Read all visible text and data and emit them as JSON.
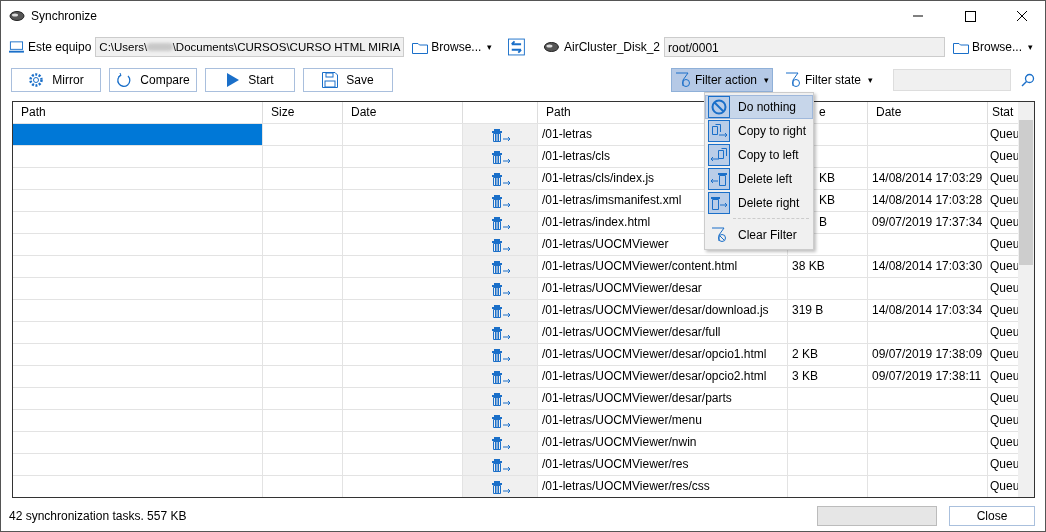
{
  "window": {
    "title": "Synchronize"
  },
  "left_location": {
    "label": "Este equipo",
    "path_before": "C:\\Users\\",
    "path_after": "\\Documents\\CURSOS\\CURSO HTML MIRIA",
    "browse": "Browse...",
    "caret": "▾"
  },
  "right_location": {
    "label": "AirCluster_Disk_2",
    "path": "root/0001",
    "browse": "Browse...",
    "caret": "▾"
  },
  "toolbar": {
    "buttons": [
      {
        "kind": "mirror",
        "label": "Mirror"
      },
      {
        "kind": "compare",
        "label": "Compare"
      },
      {
        "kind": "start",
        "label": "Start"
      },
      {
        "kind": "save",
        "label": "Save"
      }
    ],
    "filter_action": {
      "label": "Filter action",
      "caret": "▾",
      "open": true
    },
    "filter_state": {
      "label": "Filter state",
      "caret": "▾"
    }
  },
  "table": {
    "columns": [
      "Path",
      "Size",
      "Date",
      "",
      "Path",
      "e",
      "Date",
      "Stat"
    ],
    "rows": [
      {
        "right_path": "/01-letras",
        "size": "",
        "date": "",
        "state": "Queu",
        "selected": true
      },
      {
        "right_path": "/01-letras/cls",
        "size": "",
        "date": "",
        "state": "Queu",
        "selected": false
      },
      {
        "right_path": "/01-letras/cls/index.js",
        "size": "KB",
        "date": "14/08/2014 17:03:29",
        "state": "Queu",
        "selected": false
      },
      {
        "right_path": "/01-letras/imsmanifest.xml",
        "size": "KB",
        "date": "14/08/2014 17:03:28",
        "state": "Queu",
        "selected": false
      },
      {
        "right_path": "/01-letras/index.html",
        "size": "B",
        "date": "09/07/2019 17:37:34",
        "state": "Queu",
        "selected": false
      },
      {
        "right_path": "/01-letras/UOCMViewer",
        "size": "",
        "date": "",
        "state": "Queu",
        "selected": false
      },
      {
        "right_path": "/01-letras/UOCMViewer/content.html",
        "size": "38 KB",
        "date": "14/08/2014 17:03:30",
        "state": "Queu",
        "selected": false
      },
      {
        "right_path": "/01-letras/UOCMViewer/desar",
        "size": "",
        "date": "",
        "state": "Queu",
        "selected": false
      },
      {
        "right_path": "/01-letras/UOCMViewer/desar/download.js",
        "size": "319 B",
        "date": "14/08/2014 17:03:34",
        "state": "Queu",
        "selected": false
      },
      {
        "right_path": "/01-letras/UOCMViewer/desar/full",
        "size": "",
        "date": "",
        "state": "Queu",
        "selected": false
      },
      {
        "right_path": "/01-letras/UOCMViewer/desar/opcio1.html",
        "size": "2 KB",
        "date": "09/07/2019 17:38:09",
        "state": "Queu",
        "selected": false
      },
      {
        "right_path": "/01-letras/UOCMViewer/desar/opcio2.html",
        "size": "3 KB",
        "date": "09/07/2019 17:38:11",
        "state": "Queu",
        "selected": false
      },
      {
        "right_path": "/01-letras/UOCMViewer/desar/parts",
        "size": "",
        "date": "",
        "state": "Queu",
        "selected": false
      },
      {
        "right_path": "/01-letras/UOCMViewer/menu",
        "size": "",
        "date": "",
        "state": "Queu",
        "selected": false
      },
      {
        "right_path": "/01-letras/UOCMViewer/nwin",
        "size": "",
        "date": "",
        "state": "Queu",
        "selected": false
      },
      {
        "right_path": "/01-letras/UOCMViewer/res",
        "size": "",
        "date": "",
        "state": "Queu",
        "selected": false
      },
      {
        "right_path": "/01-letras/UOCMViewer/res/css",
        "size": "",
        "date": "",
        "state": "Queu",
        "selected": false
      }
    ]
  },
  "filter_menu": {
    "items": [
      {
        "kind": "nothing",
        "label": "Do nothing",
        "checked": true,
        "selected": true
      },
      {
        "kind": "copy_right",
        "label": "Copy to right",
        "checked": true,
        "selected": false
      },
      {
        "kind": "copy_left",
        "label": "Copy to left",
        "checked": true,
        "selected": false
      },
      {
        "kind": "delete_left",
        "label": "Delete left",
        "checked": true,
        "selected": false
      },
      {
        "kind": "delete_right",
        "label": "Delete right",
        "checked": true,
        "selected": false
      }
    ],
    "clear": "Clear Filter"
  },
  "status_bar": {
    "text": "42 synchronization tasks. 557 KB",
    "progress": {
      "level": 0
    },
    "close": "Close"
  }
}
